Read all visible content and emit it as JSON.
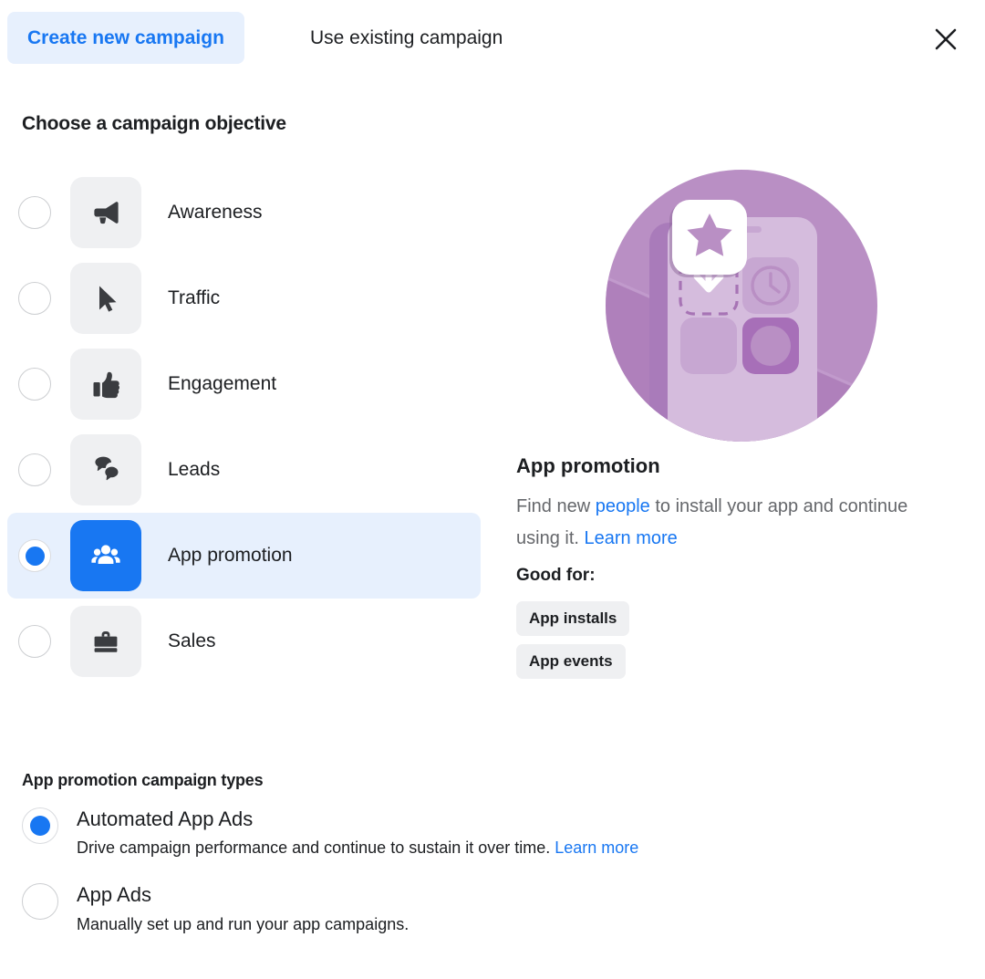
{
  "header": {
    "tab_create_label": "Create new campaign",
    "tab_existing_label": "Use existing campaign",
    "close_icon": "close-icon",
    "active_tab_color": "#1877f2",
    "active_tab_bg": "#e7f0fd"
  },
  "objective_section": {
    "title": "Choose a campaign objective",
    "selected": "App promotion",
    "items": [
      {
        "label": "Awareness",
        "icon": "megaphone-icon",
        "selected": false
      },
      {
        "label": "Traffic",
        "icon": "cursor-icon",
        "selected": false
      },
      {
        "label": "Engagement",
        "icon": "thumbs-up-icon",
        "selected": false
      },
      {
        "label": "Leads",
        "icon": "chat-bubbles-icon",
        "selected": false
      },
      {
        "label": "App promotion",
        "icon": "people-group-icon",
        "selected": true
      },
      {
        "label": "Sales",
        "icon": "briefcase-icon",
        "selected": false
      }
    ]
  },
  "detail": {
    "illustration": "app-promotion-illustration",
    "title": "App promotion",
    "desc_part1": "Find new ",
    "desc_link1": "people",
    "desc_part2": " to install your app and continue using it. ",
    "desc_link2": "Learn more",
    "good_for_label": "Good for:",
    "badges": [
      "App installs",
      "App events"
    ],
    "illustration_colors": {
      "circle": "#b98fc4",
      "circle_dark": "#a774b5",
      "phone_light": "#d5bcdd",
      "tile": "#c7a7d2",
      "tile_dark": "#a76fb8",
      "card_white": "#ffffff",
      "star": "#b98fc4"
    }
  },
  "campaign_types": {
    "title": "App promotion campaign types",
    "options": [
      {
        "label": "Automated App Ads",
        "desc": "Drive campaign performance and continue to sustain it over time. ",
        "link": "Learn more",
        "selected": true
      },
      {
        "label": "App Ads",
        "desc": "Manually set up and run your app campaigns.",
        "link": "",
        "selected": false
      }
    ]
  },
  "colors": {
    "accent": "#1877f2",
    "text": "#1c1e21",
    "muted": "#65676b",
    "icon_bg": "#eff0f2",
    "selected_row_bg": "#e7f0fd"
  }
}
